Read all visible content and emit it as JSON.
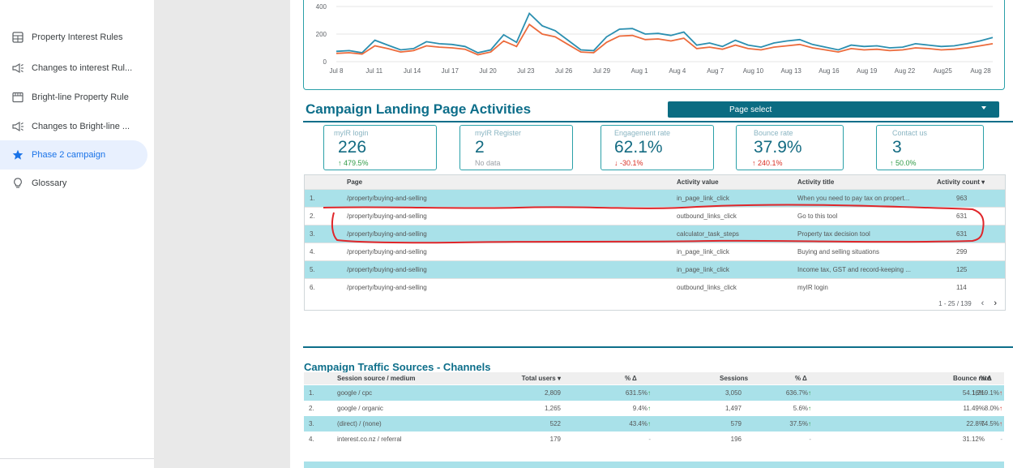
{
  "sidebar": {
    "items": [
      {
        "label": "Property Interest Rules",
        "icon": "grid-table-icon"
      },
      {
        "label": "Changes to interest Rul...",
        "icon": "megaphone-icon"
      },
      {
        "label": "Bright-line Property Rule",
        "icon": "storefront-icon"
      },
      {
        "label": "Changes to Bright-line ...",
        "icon": "megaphone-icon"
      },
      {
        "label": "Phase 2 campaign",
        "icon": "star-icon",
        "active": true
      },
      {
        "label": "Glossary",
        "icon": "lightbulb-icon"
      }
    ]
  },
  "chart_data": {
    "type": "line",
    "y_ticks": [
      "400",
      "200",
      "0"
    ],
    "ylim": [
      0,
      400
    ],
    "x_ticks": [
      "Jul 8",
      "Jul 11",
      "Jul 14",
      "Jul 17",
      "Jul 20",
      "Jul 23",
      "Jul 26",
      "Jul 29",
      "Aug 1",
      "Aug 4",
      "Aug 7",
      "Aug 10",
      "Aug 13",
      "Aug 16",
      "Aug 19",
      "Aug 22",
      "Aug25",
      "Aug 28"
    ],
    "series": [
      {
        "color": "#2b8fb0",
        "values": [
          75,
          80,
          65,
          155,
          120,
          85,
          95,
          145,
          130,
          125,
          110,
          65,
          85,
          195,
          140,
          350,
          260,
          225,
          155,
          85,
          80,
          180,
          235,
          240,
          200,
          205,
          190,
          215,
          120,
          135,
          110,
          155,
          120,
          105,
          135,
          150,
          160,
          125,
          105,
          85,
          120,
          110,
          115,
          100,
          105,
          130,
          120,
          110,
          115,
          130,
          150,
          175
        ]
      },
      {
        "color": "#ec6b3c",
        "values": [
          60,
          65,
          55,
          115,
          95,
          70,
          80,
          115,
          105,
          100,
          90,
          50,
          70,
          150,
          110,
          270,
          200,
          180,
          125,
          70,
          65,
          140,
          185,
          190,
          160,
          165,
          150,
          170,
          95,
          105,
          90,
          120,
          95,
          85,
          105,
          115,
          125,
          100,
          85,
          70,
          95,
          85,
          90,
          80,
          85,
          100,
          95,
          85,
          90,
          100,
          115,
          130
        ]
      }
    ]
  },
  "landing": {
    "title": "Campaign Landing Page Activities",
    "page_select_label": "Page select"
  },
  "kpis": [
    {
      "label": "myIR login",
      "value": "226",
      "delta": "479.5%",
      "direction": "up"
    },
    {
      "label": "myIR Register",
      "value": "2",
      "delta": "No data",
      "direction": "none"
    },
    {
      "label": "Engagement rate",
      "value": "62.1%",
      "delta": "-30.1%",
      "direction": "down"
    },
    {
      "label": "Bounce rate",
      "value": "37.9%",
      "delta": "240.1%",
      "direction": "down"
    },
    {
      "label": "Contact us",
      "value": "3",
      "delta": "50.0%",
      "direction": "up"
    }
  ],
  "activities": {
    "headers": {
      "page": "Page",
      "value": "Activity value",
      "title": "Activity title",
      "count": "Activity count"
    },
    "rows": [
      {
        "n": "1.",
        "page": "/property/buying-and-selling",
        "value": "in_page_link_click",
        "title": "When you need to pay tax on propert...",
        "count": "963"
      },
      {
        "n": "2.",
        "page": "/property/buying-and-selling",
        "value": "outbound_links_click",
        "title": "Go to this tool",
        "count": "631"
      },
      {
        "n": "3.",
        "page": "/property/buying-and-selling",
        "value": "calculator_task_steps",
        "title": "Property tax decision tool",
        "count": "631"
      },
      {
        "n": "4.",
        "page": "/property/buying-and-selling",
        "value": "in_page_link_click",
        "title": "Buying and selling situations",
        "count": "299"
      },
      {
        "n": "5.",
        "page": "/property/buying-and-selling",
        "value": "in_page_link_click",
        "title": "Income tax, GST and record-keeping ...",
        "count": "125"
      },
      {
        "n": "6.",
        "page": "/property/buying-and-selling",
        "value": "outbound_links_click",
        "title": "myIR login",
        "count": "114"
      }
    ],
    "pagination": "1 - 25 / 139"
  },
  "traffic": {
    "title": "Campaign Traffic Sources - Channels",
    "headers": {
      "source": "Session source / medium",
      "users": "Total users",
      "users_delta": "% Δ",
      "sessions": "Sessions",
      "sessions_delta": "% Δ",
      "bounce": "Bounce rate",
      "bounce_delta": "% Δ"
    },
    "rows": [
      {
        "n": "1.",
        "source": "google / cpc",
        "users": "2,809",
        "users_delta": "631.5%",
        "sessions": "3,050",
        "sessions_delta": "636.7%",
        "bounce": "54.16%",
        "bounce_delta": "1,219.1%"
      },
      {
        "n": "2.",
        "source": "google / organic",
        "users": "1,265",
        "users_delta": "9.4%",
        "sessions": "1,497",
        "sessions_delta": "5.6%",
        "bounce": "11.49%",
        "bounce_delta": "8.0%"
      },
      {
        "n": "3.",
        "source": "(direct) / (none)",
        "users": "522",
        "users_delta": "43.4%",
        "sessions": "579",
        "sessions_delta": "37.5%",
        "bounce": "22.8%",
        "bounce_delta": "74.5%"
      },
      {
        "n": "4.",
        "source": "interest.co.nz / referral",
        "users": "179",
        "users_delta": "-",
        "sessions": "196",
        "sessions_delta": "-",
        "bounce": "31.12%",
        "bounce_delta": "-"
      }
    ]
  }
}
